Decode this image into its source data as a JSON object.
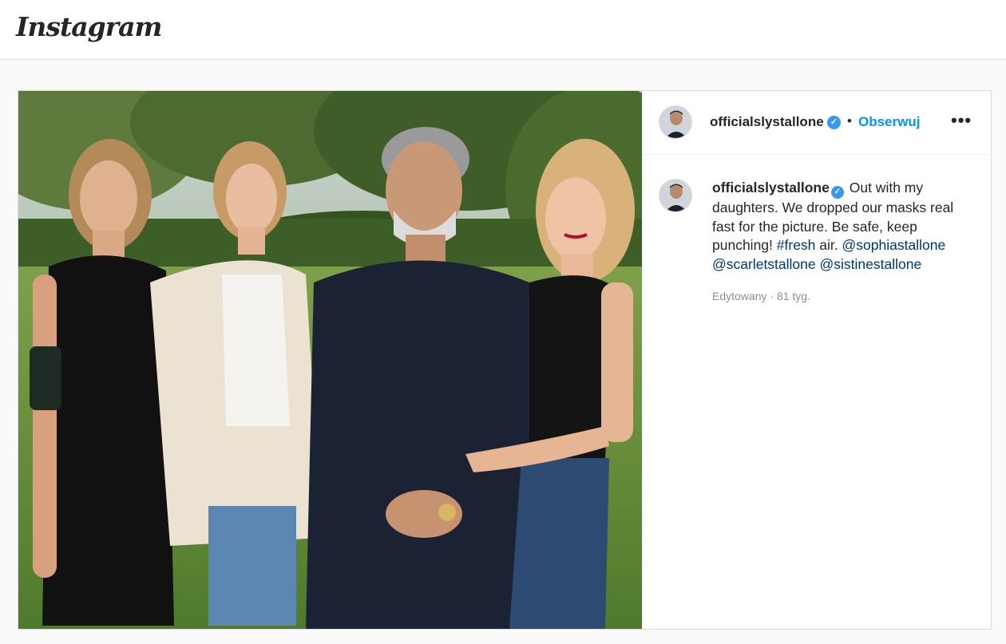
{
  "header": {
    "logo_text": "Instagram"
  },
  "post": {
    "author": {
      "username": "officialslystallone",
      "verified_icon": "check"
    },
    "separator": "•",
    "follow_label": "Obserwuj",
    "more_label": "•••",
    "caption": {
      "username": "officialslystallone",
      "text_1": "Out with my daughters. We dropped our masks real fast for the picture. Be safe, keep punching!",
      "hashtag": "#fresh",
      "text_2": "air.",
      "mention_1": "@sophiastallone",
      "mention_2": "@scarletstallone",
      "mention_3": "@sistinestallone"
    },
    "meta": "Edytowany · 81 tyg."
  },
  "colors": {
    "link_blue": "#0095f6",
    "verified_blue": "#3897f0",
    "mention_blue": "#00376b",
    "muted": "#8e8e8e"
  }
}
